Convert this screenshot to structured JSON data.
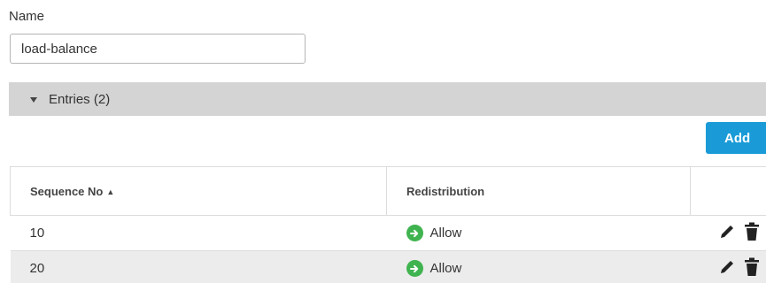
{
  "form": {
    "name_label": "Name",
    "name_value": "load-balance"
  },
  "section": {
    "title": "Entries (2)",
    "icon": "caret-down-icon"
  },
  "toolbar": {
    "add_label": "Add",
    "add_color": "#1a9bd7"
  },
  "table": {
    "columns": [
      "Sequence No",
      "Redistribution",
      ""
    ],
    "sort_indicator": "▲",
    "rows": [
      {
        "sequence": "10",
        "redistribution": "Allow"
      },
      {
        "sequence": "20",
        "redistribution": "Allow"
      }
    ],
    "allow_icon": "arrow-right-circle-icon",
    "allow_color": "#3fb34f",
    "row_actions": [
      "edit-icon",
      "delete-icon"
    ]
  }
}
